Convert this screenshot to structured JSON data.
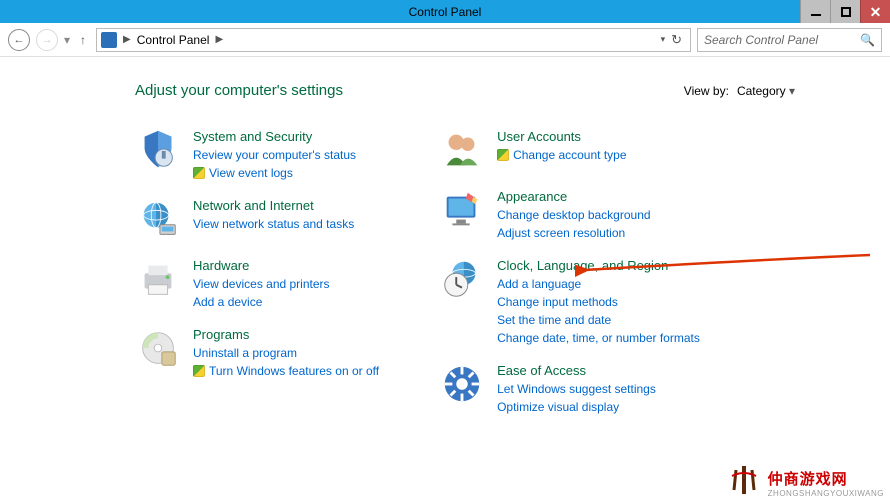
{
  "window": {
    "title": "Control Panel"
  },
  "nav": {
    "breadcrumb_root": "Control Panel",
    "search_placeholder": "Search Control Panel"
  },
  "header": {
    "heading": "Adjust your computer's settings",
    "viewby_label": "View by:",
    "viewby_value": "Category"
  },
  "categories_left": [
    {
      "title": "System and Security",
      "links": [
        {
          "label": "Review your computer's status",
          "shield": false
        },
        {
          "label": "View event logs",
          "shield": true
        }
      ]
    },
    {
      "title": "Network and Internet",
      "links": [
        {
          "label": "View network status and tasks",
          "shield": false
        }
      ]
    },
    {
      "title": "Hardware",
      "links": [
        {
          "label": "View devices and printers",
          "shield": false
        },
        {
          "label": "Add a device",
          "shield": false
        }
      ]
    },
    {
      "title": "Programs",
      "links": [
        {
          "label": "Uninstall a program",
          "shield": false
        },
        {
          "label": "Turn Windows features on or off",
          "shield": true
        }
      ]
    }
  ],
  "categories_right": [
    {
      "title": "User Accounts",
      "links": [
        {
          "label": "Change account type",
          "shield": true
        }
      ]
    },
    {
      "title": "Appearance",
      "links": [
        {
          "label": "Change desktop background",
          "shield": false
        },
        {
          "label": "Adjust screen resolution",
          "shield": false
        }
      ]
    },
    {
      "title": "Clock, Language, and Region",
      "links": [
        {
          "label": "Add a language",
          "shield": false
        },
        {
          "label": "Change input methods",
          "shield": false
        },
        {
          "label": "Set the time and date",
          "shield": false
        },
        {
          "label": "Change date, time, or number formats",
          "shield": false
        }
      ]
    },
    {
      "title": "Ease of Access",
      "links": [
        {
          "label": "Let Windows suggest settings",
          "shield": false
        },
        {
          "label": "Optimize visual display",
          "shield": false
        }
      ]
    }
  ],
  "watermark": {
    "text": "仲商游戏网",
    "sub": "ZHONGSHANGYOUXIWANG"
  }
}
